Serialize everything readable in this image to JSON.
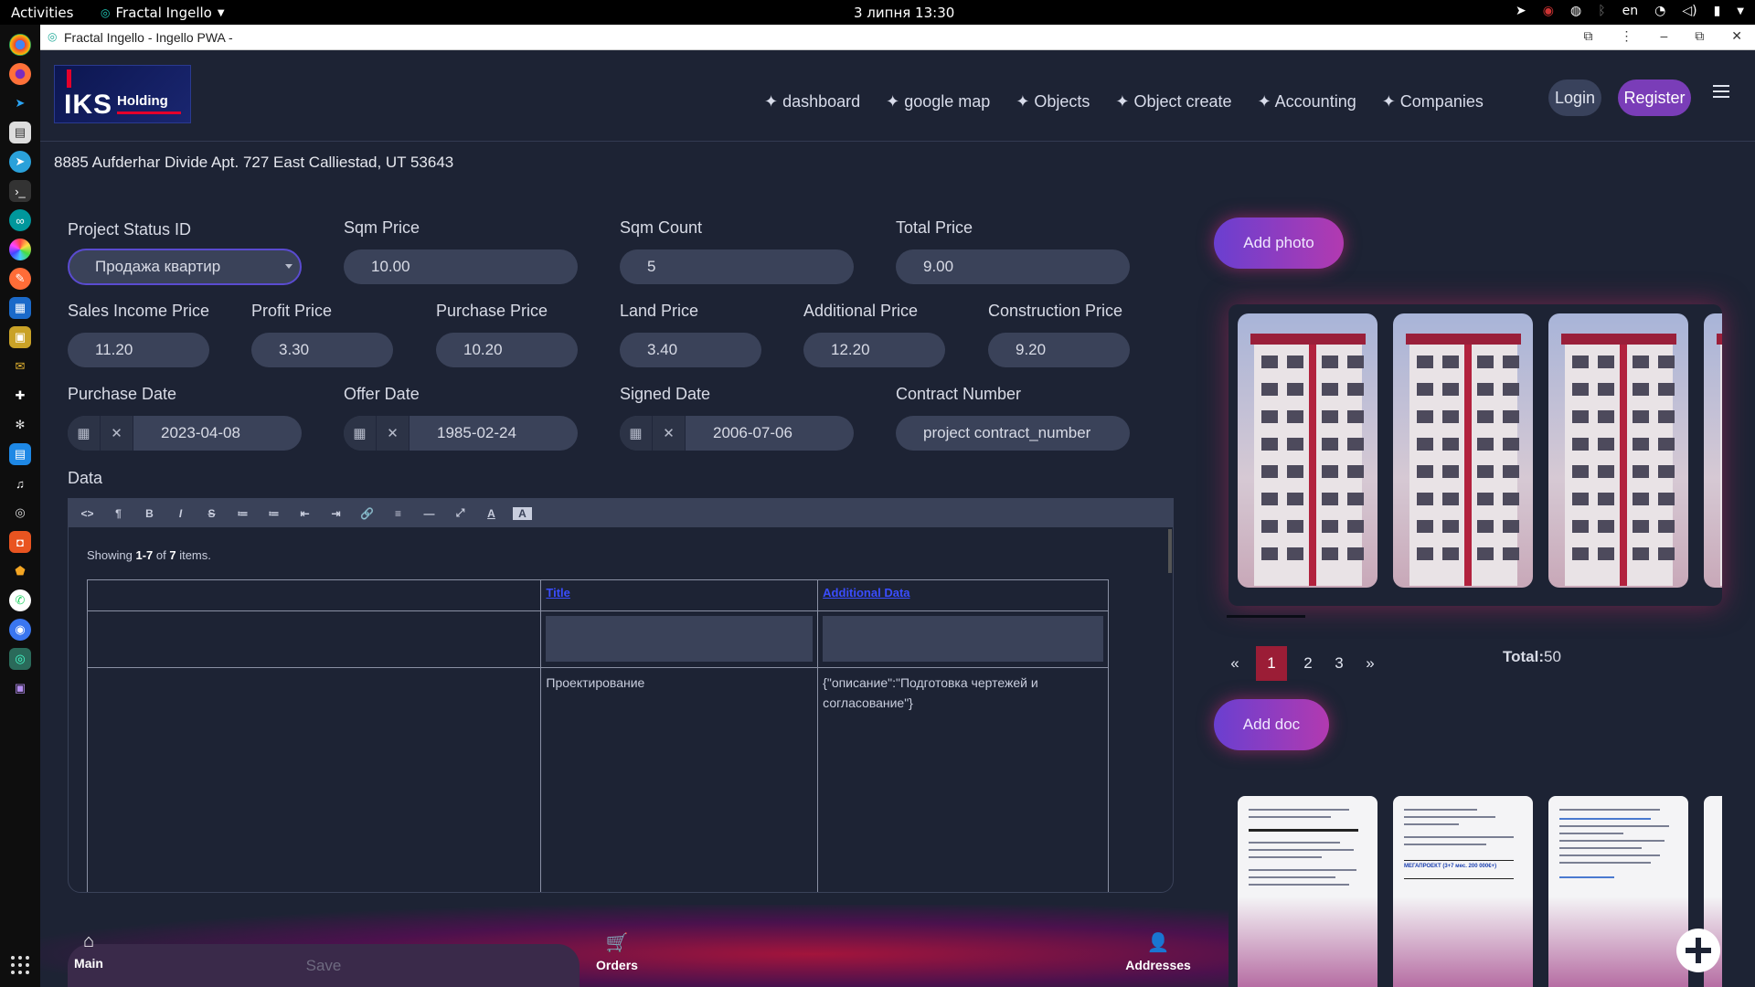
{
  "system": {
    "activities": "Activities",
    "app_name": "Fractal Ingello",
    "clock": "3 липня  13:30",
    "lang": "en"
  },
  "browser": {
    "title": "Fractal Ingello - Ingello PWA -"
  },
  "header": {
    "logo_text": "IKS",
    "logo_sub": "Holding",
    "nav": [
      "✦ dashboard",
      "✦ google map",
      "✦ Objects",
      "✦ Object create",
      "✦ Accounting",
      "✦ Companies"
    ],
    "login": "Login",
    "register": "Register"
  },
  "address": "8885 Aufderhar Divide Apt. 727 East Calliestad, UT 53643",
  "form": {
    "project_status_label": "Project Status ID",
    "project_status_value": "Продажа квартир",
    "sqm_price_label": "Sqm Price",
    "sqm_price_value": "10.00",
    "sqm_count_label": "Sqm Count",
    "sqm_count_value": "5",
    "total_price_label": "Total Price",
    "total_price_value": "9.00",
    "sales_income_label": "Sales Income Price",
    "sales_income_value": "11.20",
    "profit_label": "Profit Price",
    "profit_value": "3.30",
    "purchase_price_label": "Purchase Price",
    "purchase_price_value": "10.20",
    "land_label": "Land Price",
    "land_value": "3.40",
    "additional_label": "Additional Price",
    "additional_value": "12.20",
    "construction_label": "Construction Price",
    "construction_value": "9.20",
    "purchase_date_label": "Purchase Date",
    "purchase_date_value": "2023-04-08",
    "offer_date_label": "Offer Date",
    "offer_date_value": "1985-02-24",
    "signed_date_label": "Signed Date",
    "signed_date_value": "2006-07-06",
    "contract_label": "Contract Number",
    "contract_value": "project contract_number",
    "data_label": "Data",
    "save": "Save"
  },
  "editor": {
    "toolbar": [
      "<>",
      "¶",
      "B",
      "I",
      "S",
      "≔",
      "≔",
      "⇤",
      "⇥",
      "🔗",
      "≡",
      "—",
      "⤢",
      "A",
      "A"
    ],
    "showing_prefix": "Showing ",
    "showing_range": "1-7",
    "showing_of": " of ",
    "showing_total": "7",
    "showing_suffix": " items.",
    "columns": [
      "",
      "Title",
      "Additional Data"
    ],
    "rows": [
      {
        "title": "Проектирование",
        "additional": "{\"описание\":\"Подготовка чертежей и согласование\"}"
      }
    ]
  },
  "media": {
    "add_photo": "Add photo",
    "add_doc": "Add doc",
    "pages": [
      "«",
      "1",
      "2",
      "3",
      "»"
    ],
    "active_page": "1",
    "total_label": "Total:",
    "total_value": "50",
    "doc_caption": "МЕГАПРОЕКТ (3+7 мес. 200 000€+)"
  },
  "bottom_nav": {
    "main": "Main",
    "orders": "Orders",
    "addresses": "Addresses"
  }
}
